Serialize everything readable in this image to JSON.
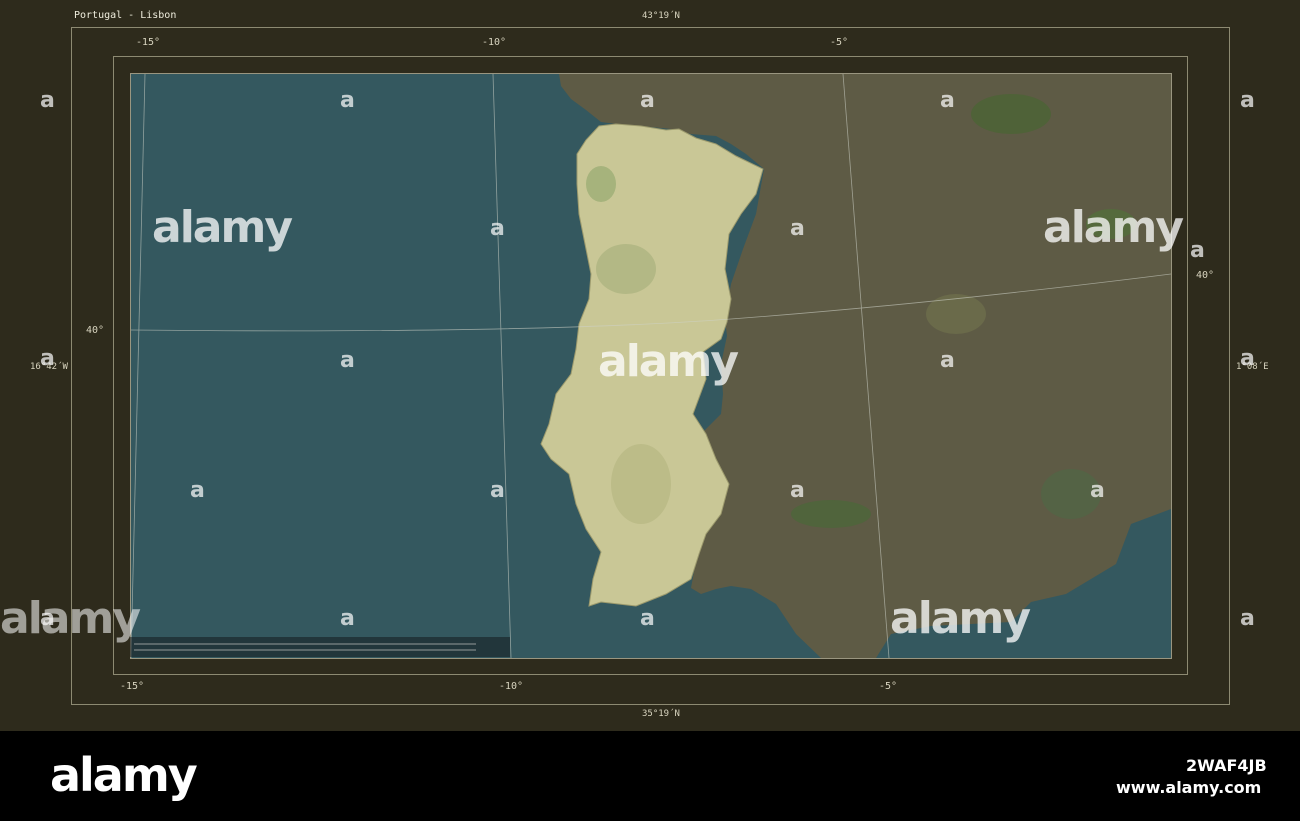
{
  "map": {
    "title": "Portugal - Lisbon",
    "bounds": {
      "north": "43°19´N",
      "south": "35°19´N",
      "west": "16°42´W",
      "east": "1°08´E"
    },
    "longitude_ticks_top": [
      "-15°",
      "-10°",
      "-5°"
    ],
    "longitude_ticks_bottom": [
      "-15°",
      "-10°",
      "-5°"
    ],
    "latitude_ticks_left": [
      "40°"
    ],
    "latitude_ticks_right": [
      "40°"
    ],
    "highlighted_country": "Portugal",
    "colors": {
      "sea": "#34585f",
      "land": "#5e5b45",
      "highlight": "#c9c796",
      "frame": "#2e2b1c",
      "graticule": "#cfd2c8"
    }
  },
  "watermark": {
    "brand": "alamy",
    "image_id": "2WAF4JB",
    "url": "www.alamy.com"
  }
}
